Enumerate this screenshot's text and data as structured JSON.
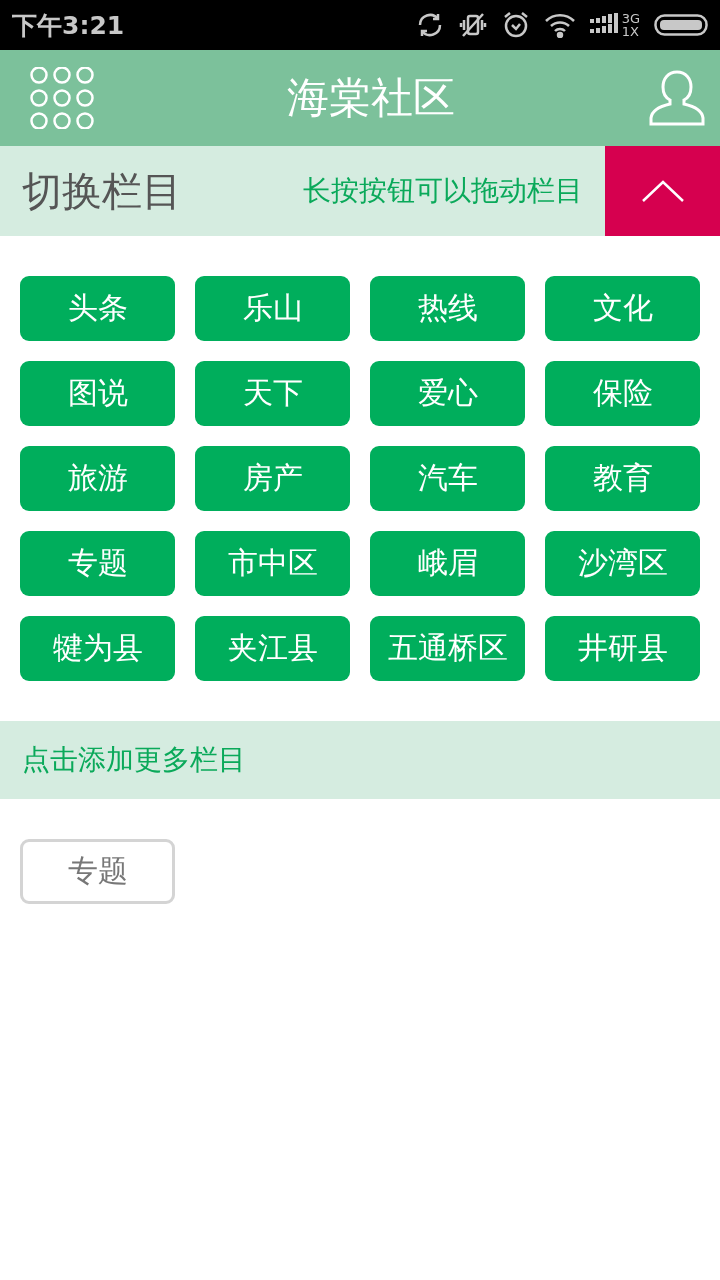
{
  "status_bar": {
    "time": "下午3:21",
    "network_top": "3G",
    "network_bottom": "1X"
  },
  "header": {
    "title": "海棠社区"
  },
  "switch_bar": {
    "title": "切换栏目",
    "hint": "长按按钮可以拖动栏目"
  },
  "my_channels": [
    "头条",
    "乐山",
    "热线",
    "文化",
    "图说",
    "天下",
    "爱心",
    "保险",
    "旅游",
    "房产",
    "汽车",
    "教育",
    "专题",
    "市中区",
    "峨眉",
    "沙湾区",
    "犍为县",
    "夹江县",
    "五通桥区",
    "井研县"
  ],
  "more_bar": {
    "title": "点击添加更多栏目"
  },
  "more_channels": [
    "专题"
  ]
}
